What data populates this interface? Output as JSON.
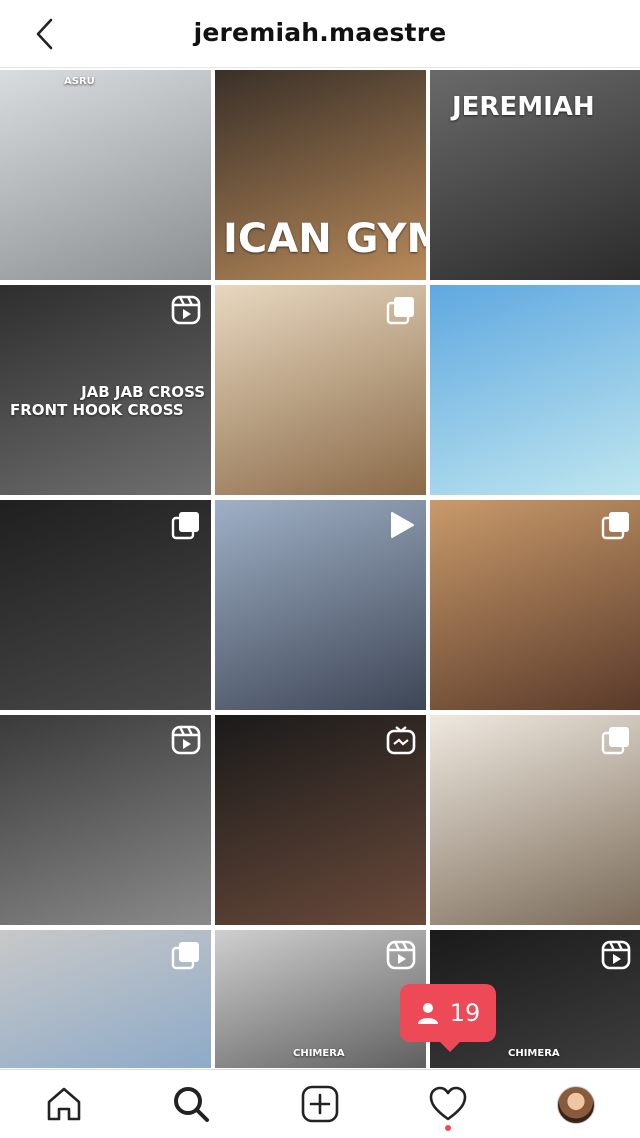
{
  "header": {
    "username": "jeremiah.maestre"
  },
  "grid": {
    "posts": [
      {
        "name": "post-studio-jacket",
        "glyph": "",
        "overlay": "ASRU",
        "colors": [
          "#d9dcdf",
          "#8b8f92"
        ]
      },
      {
        "name": "post-gym-sign",
        "glyph": "",
        "overlay": "ICAN GYM",
        "colors": [
          "#3a3028",
          "#b88a5a"
        ]
      },
      {
        "name": "post-logo-banner",
        "glyph": "",
        "overlay": "JEREMIAH",
        "colors": [
          "#6a6a6a",
          "#2b2b2b"
        ]
      },
      {
        "name": "post-jab-cross",
        "glyph": "reel-icon",
        "overlay": "JAB JAB CROSS",
        "overlay2": "FRONT HOOK CROSS",
        "colors": [
          "#2e2e2e",
          "#6f6f6f"
        ]
      },
      {
        "name": "post-couple-indoor",
        "glyph": "carousel-icon",
        "overlay": "",
        "colors": [
          "#e8d8c0",
          "#8a6a48"
        ]
      },
      {
        "name": "post-beach-couple",
        "glyph": "",
        "overlay": "",
        "colors": [
          "#5fa8e0",
          "#bfe6ef"
        ]
      },
      {
        "name": "post-training-stick",
        "glyph": "carousel-icon",
        "overlay": "",
        "colors": [
          "#1f1f1f",
          "#4a4a4a"
        ]
      },
      {
        "name": "post-headphones-punch",
        "glyph": "video-icon",
        "overlay": "",
        "colors": [
          "#9fb0c6",
          "#3e4656"
        ]
      },
      {
        "name": "post-heavy-bag",
        "glyph": "carousel-icon",
        "overlay": "",
        "colors": [
          "#c99a6a",
          "#5a3a2a"
        ]
      },
      {
        "name": "post-bag-work",
        "glyph": "reel-icon",
        "overlay": "",
        "colors": [
          "#3a3a3a",
          "#8a8a8a"
        ]
      },
      {
        "name": "post-raptors-jersey",
        "glyph": "igtv-icon",
        "overlay": "",
        "colors": [
          "#1a1a1a",
          "#6a4a3a"
        ]
      },
      {
        "name": "post-family",
        "glyph": "carousel-icon",
        "overlay": "",
        "colors": [
          "#efe9e0",
          "#7a6a58"
        ]
      },
      {
        "name": "post-ring-sparring",
        "glyph": "carousel-icon",
        "overlay": "",
        "colors": [
          "#c8c8c8",
          "#7aa0c8"
        ]
      },
      {
        "name": "post-wrapping-hands",
        "glyph": "reel-icon",
        "overlay": "CHIMERA",
        "colors": [
          "#cfcfcf",
          "#3a3a3a"
        ]
      },
      {
        "name": "post-chimera-portrait",
        "glyph": "reel-icon",
        "overlay": "CHIMERA",
        "colors": [
          "#1a1a1a",
          "#4a4a4a"
        ]
      }
    ]
  },
  "notification": {
    "count": "19"
  },
  "tabbar": {
    "items": [
      "home-icon",
      "search-icon",
      "add-post-icon",
      "activity-icon",
      "profile-avatar"
    ]
  }
}
